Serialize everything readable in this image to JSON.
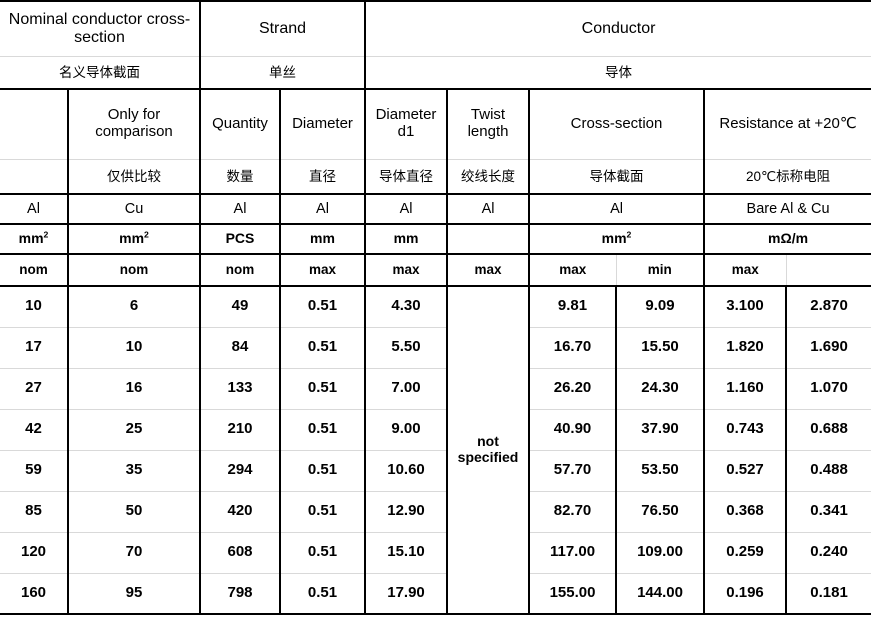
{
  "document": {
    "type": "specification-table",
    "title": "Aluminium conductor specification table",
    "language": "bilingual-en-zh"
  },
  "colors": {
    "border_strong": "#000000",
    "border_light": "#d9d9d9",
    "background": "#ffffff",
    "text": "#000000"
  },
  "header": {
    "groups": {
      "nominal_cross_section_en": "Nominal conductor cross-section",
      "nominal_cross_section_zh": "名义导体截面",
      "strand_en": "Strand",
      "strand_zh": "单丝",
      "conductor_en": "Conductor",
      "conductor_zh": "导体"
    },
    "columns_en": {
      "c1": "",
      "c2": "Only for comparison",
      "c3": "Quantity",
      "c4": "Diameter",
      "c5": "Diameter d1",
      "c6": "Twist length",
      "c7": "Cross-section",
      "c8": "Resistance at +20℃"
    },
    "columns_zh": {
      "c1": "",
      "c2": "仅供比较",
      "c3": "数量",
      "c4": "直径",
      "c5": "导体直径",
      "c6": "绞线长度",
      "c7": "导体截面",
      "c8": "20℃标称电阻"
    },
    "materials": {
      "c1": "Al",
      "c2": "Cu",
      "c3": "Al",
      "c4": "Al",
      "c5": "Al",
      "c6": "Al",
      "c7": "Al",
      "c8": "Bare Al & Cu"
    },
    "units": {
      "c1_base": "mm",
      "c1_sup": "2",
      "c2_base": "mm",
      "c2_sup": "2",
      "c3": "PCS",
      "c4": "mm",
      "c5": "mm",
      "c6": "",
      "c7_base": "mm",
      "c7_sup": "2",
      "c8": "mΩ/m"
    },
    "qualifiers": {
      "c1": "nom",
      "c2": "nom",
      "c3": "nom",
      "c4": "max",
      "c5": "max",
      "c6": "max",
      "c7_max": "max",
      "c7_min": "min",
      "c8_max": "max",
      "c8_second": ""
    }
  },
  "twist_length_value": "not specified",
  "rows": [
    {
      "al_nom": "10",
      "cu_nom": "6",
      "quantity": "49",
      "strand_diameter": "0.51",
      "conductor_diameter_d1": "4.30",
      "cross_section_max": "9.81",
      "cross_section_min": "9.09",
      "resistance_max": "3.100",
      "resistance_second": "2.870"
    },
    {
      "al_nom": "17",
      "cu_nom": "10",
      "quantity": "84",
      "strand_diameter": "0.51",
      "conductor_diameter_d1": "5.50",
      "cross_section_max": "16.70",
      "cross_section_min": "15.50",
      "resistance_max": "1.820",
      "resistance_second": "1.690"
    },
    {
      "al_nom": "27",
      "cu_nom": "16",
      "quantity": "133",
      "strand_diameter": "0.51",
      "conductor_diameter_d1": "7.00",
      "cross_section_max": "26.20",
      "cross_section_min": "24.30",
      "resistance_max": "1.160",
      "resistance_second": "1.070"
    },
    {
      "al_nom": "42",
      "cu_nom": "25",
      "quantity": "210",
      "strand_diameter": "0.51",
      "conductor_diameter_d1": "9.00",
      "cross_section_max": "40.90",
      "cross_section_min": "37.90",
      "resistance_max": "0.743",
      "resistance_second": "0.688"
    },
    {
      "al_nom": "59",
      "cu_nom": "35",
      "quantity": "294",
      "strand_diameter": "0.51",
      "conductor_diameter_d1": "10.60",
      "cross_section_max": "57.70",
      "cross_section_min": "53.50",
      "resistance_max": "0.527",
      "resistance_second": "0.488"
    },
    {
      "al_nom": "85",
      "cu_nom": "50",
      "quantity": "420",
      "strand_diameter": "0.51",
      "conductor_diameter_d1": "12.90",
      "cross_section_max": "82.70",
      "cross_section_min": "76.50",
      "resistance_max": "0.368",
      "resistance_second": "0.341"
    },
    {
      "al_nom": "120",
      "cu_nom": "70",
      "quantity": "608",
      "strand_diameter": "0.51",
      "conductor_diameter_d1": "15.10",
      "cross_section_max": "117.00",
      "cross_section_min": "109.00",
      "resistance_max": "0.259",
      "resistance_second": "0.240"
    },
    {
      "al_nom": "160",
      "cu_nom": "95",
      "quantity": "798",
      "strand_diameter": "0.51",
      "conductor_diameter_d1": "17.90",
      "cross_section_max": "155.00",
      "cross_section_min": "144.00",
      "resistance_max": "0.196",
      "resistance_second": "0.181"
    }
  ]
}
